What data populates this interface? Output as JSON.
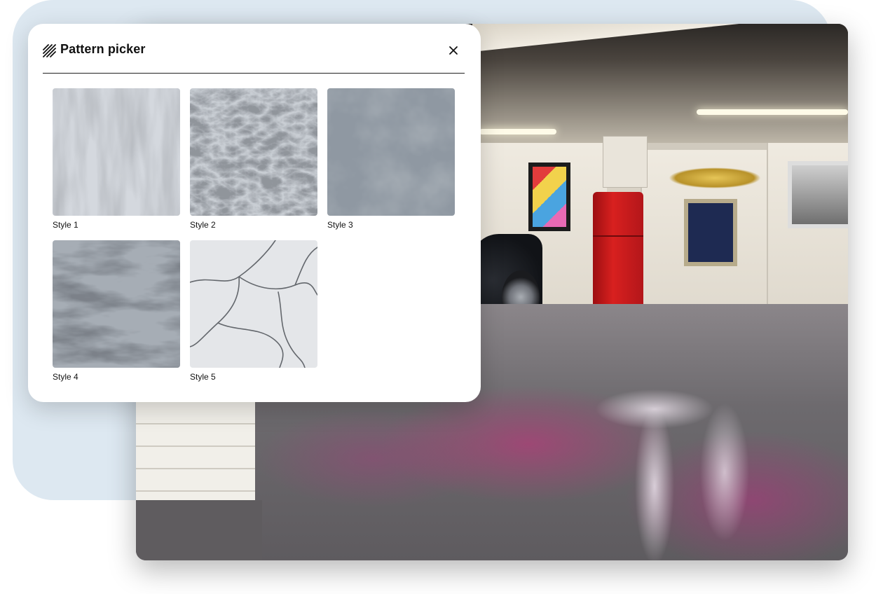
{
  "picker": {
    "title": "Pattern picker",
    "icon": "diagonal-lines-icon",
    "close_icon": "close-icon",
    "styles": [
      {
        "label": "Style 1"
      },
      {
        "label": "Style 2"
      },
      {
        "label": "Style 3"
      },
      {
        "label": "Style 4"
      },
      {
        "label": "Style 5"
      }
    ]
  },
  "scene": {
    "description_colors": {
      "floor_accent": "#b0457e",
      "panel_bg": "#ffffff",
      "backdrop": "#dde8f1"
    }
  }
}
